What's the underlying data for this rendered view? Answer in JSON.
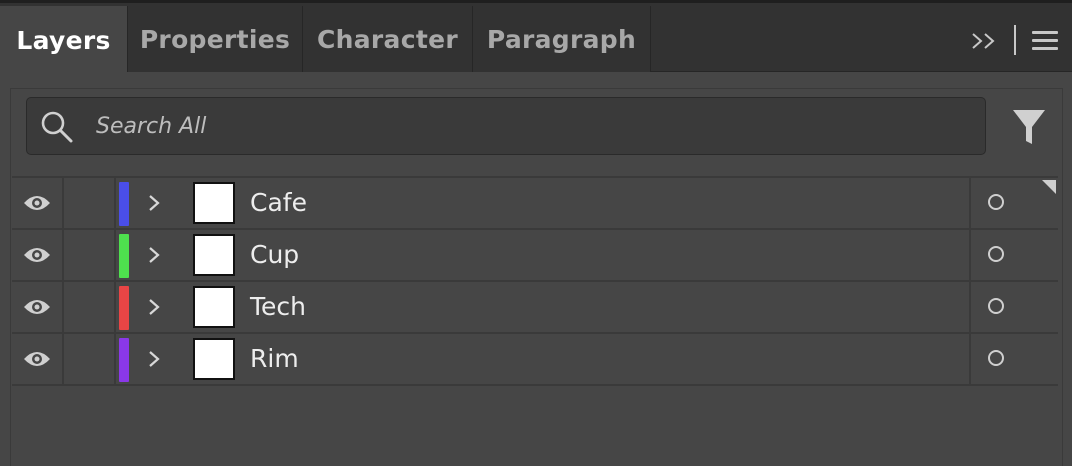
{
  "tabs": [
    {
      "label": "Layers",
      "active": true
    },
    {
      "label": "Properties",
      "active": false
    },
    {
      "label": "Character",
      "active": false
    },
    {
      "label": "Paragraph",
      "active": false
    }
  ],
  "toolbar": {
    "overflow_label": ">>",
    "menu_icon": "hamburger-menu-icon"
  },
  "search": {
    "placeholder": "Search All",
    "icon": "search-icon",
    "filter_icon": "filter-icon"
  },
  "layers": [
    {
      "name": "Cafe",
      "color": "#4a4ee8",
      "visible": true,
      "selected_indicator": true
    },
    {
      "name": "Cup",
      "color": "#4ee04e",
      "visible": true,
      "selected_indicator": false
    },
    {
      "name": "Tech",
      "color": "#e84545",
      "visible": true,
      "selected_indicator": false
    },
    {
      "name": "Rim",
      "color": "#8a38e8",
      "visible": true,
      "selected_indicator": false
    }
  ]
}
